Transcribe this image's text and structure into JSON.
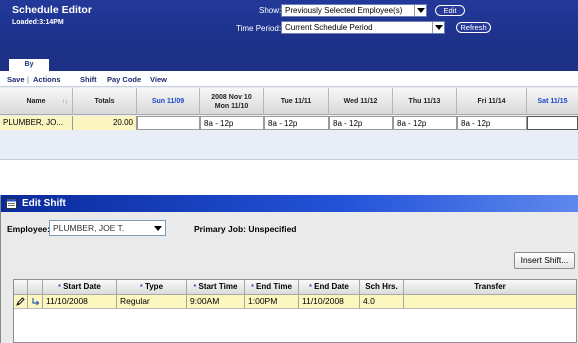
{
  "schedule_editor": {
    "title": "Schedule Editor",
    "loaded": "Loaded:3:14PM",
    "show_label": "Show:",
    "show_value": "Previously Selected Employee(s)",
    "time_period_label": "Time Period:",
    "time_period_value": "Current Schedule Period",
    "edit_label": "Edit",
    "refresh_label": "Refresh",
    "tab_label": "By Employee",
    "menu": {
      "save": "Save",
      "separator": "|",
      "actions": "Actions",
      "shift": "Shift",
      "pay_code": "Pay Code",
      "view": "View"
    },
    "columns": {
      "name": "Name",
      "totals": "Totals",
      "sun": "Sun 11/09",
      "mon_line1": "2008 Nov 10",
      "mon_line2": "Mon 11/10",
      "tue": "Tue 11/11",
      "wed": "Wed 11/12",
      "thu": "Thu 11/13",
      "fri": "Fri 11/14",
      "sat": "Sat 11/15"
    },
    "row": {
      "name": "PLUMBER, JO...",
      "totals": "20.00",
      "sun": "",
      "mon": "8a - 12p",
      "tue": "8a - 12p",
      "wed": "8a - 12p",
      "thu": "8a - 12p",
      "fri": "8a - 12p",
      "sat": ""
    }
  },
  "edit_shift": {
    "title": "Edit Shift",
    "employee_label": "Employee:",
    "employee_value": "PLUMBER, JOE T.",
    "primary_job": "Primary Job: Unspecified",
    "insert_button": "Insert Shift...",
    "columns": {
      "start_date": "Start Date",
      "type": "Type",
      "start_time": "Start Time",
      "end_time": "End Time",
      "end_date": "End Date",
      "sch_hrs": "Sch Hrs.",
      "transfer": "Transfer",
      "required_marker": "*"
    },
    "row": {
      "start_date": "11/10/2008",
      "type": "Regular",
      "start_time": "9:00AM",
      "end_time": "1:00PM",
      "end_date": "11/10/2008",
      "sch_hrs": "4.0",
      "transfer": ""
    },
    "icons": [
      "edit-pencil-icon",
      "insert-arrow-icon",
      "window-icon"
    ]
  }
}
